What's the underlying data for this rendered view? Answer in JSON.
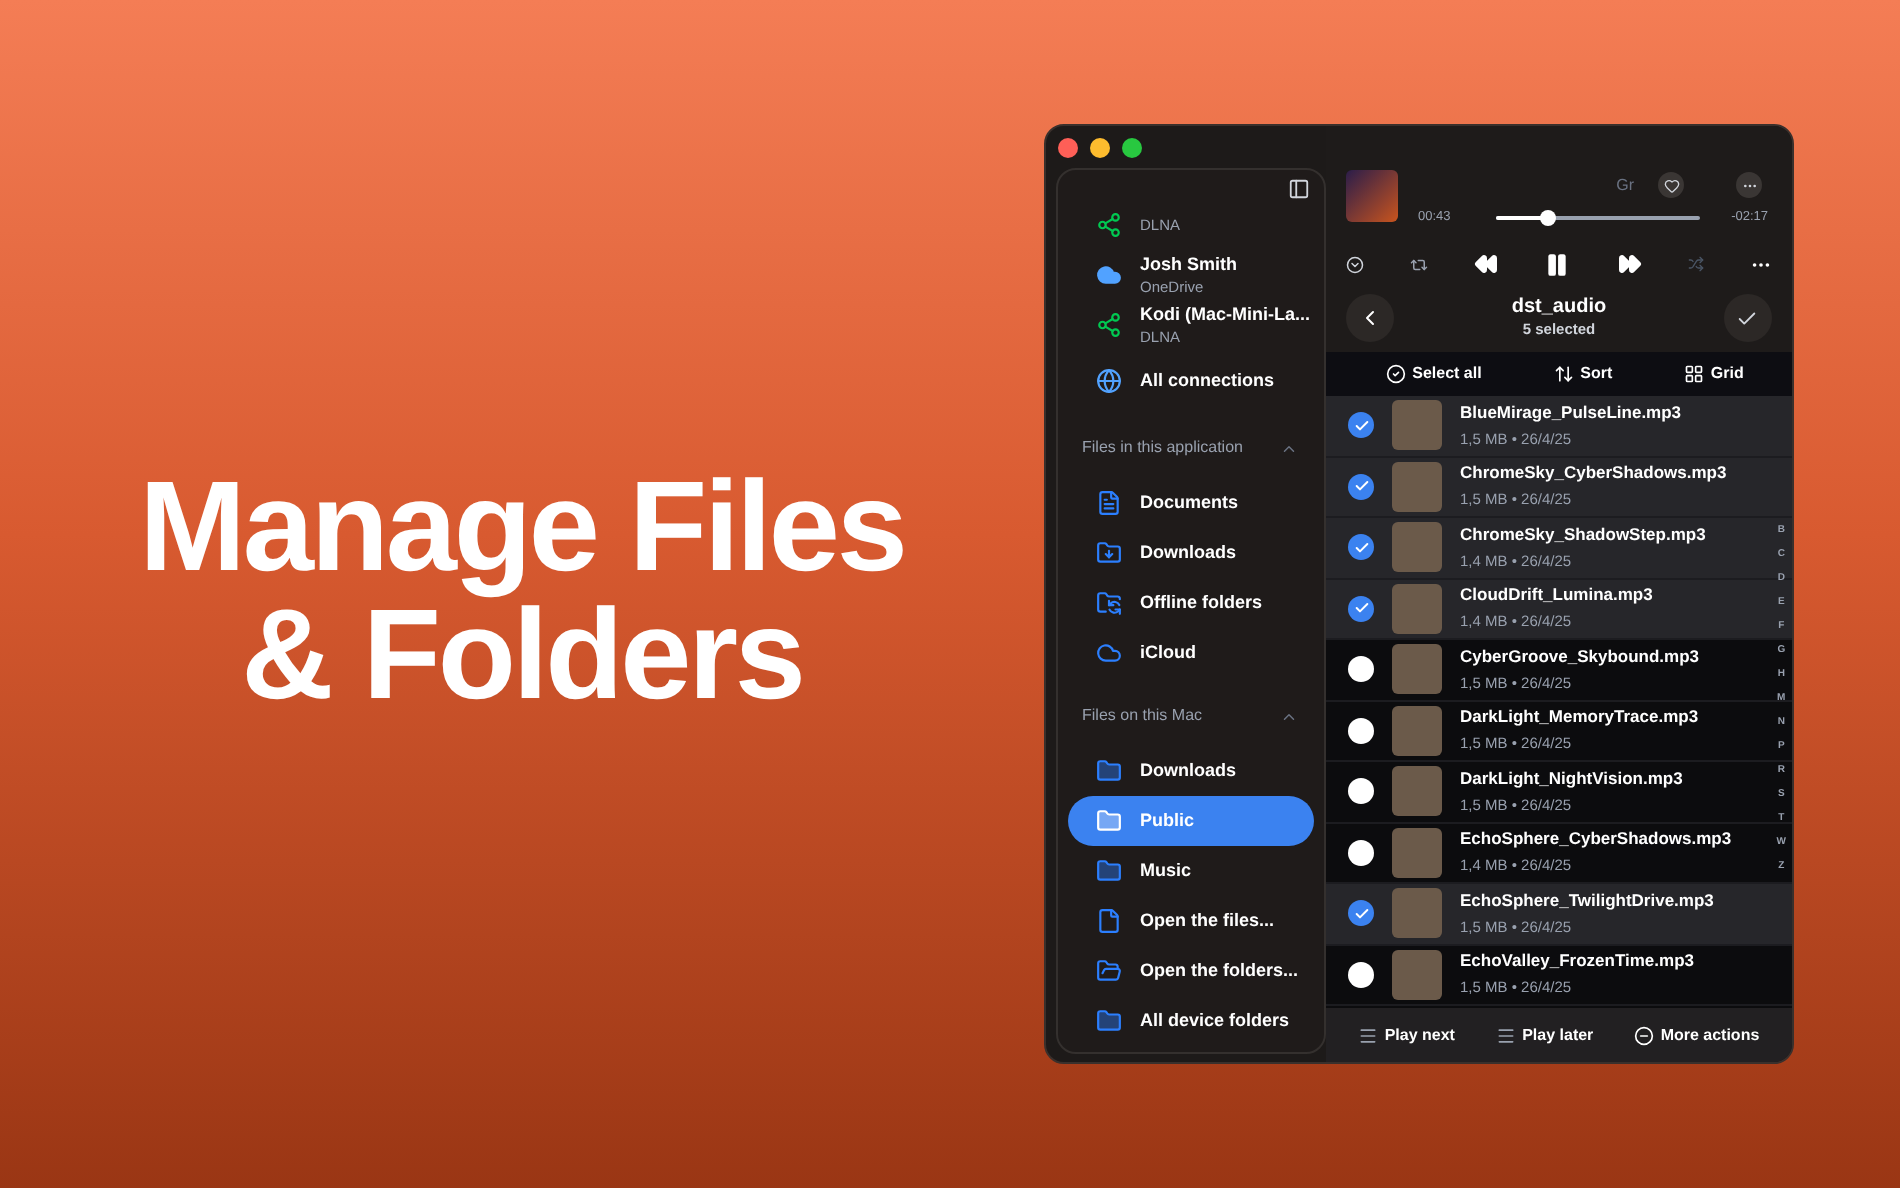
{
  "headline": [
    "Manage Files",
    "& Folders"
  ],
  "sidebar": {
    "connections": [
      {
        "service": "DLNA",
        "kind": "dlna"
      },
      {
        "name": "Josh Smith",
        "service": "OneDrive",
        "kind": "cloud"
      },
      {
        "name": "Kodi (Mac-Mini-La...",
        "service": "DLNA",
        "kind": "dlna"
      },
      {
        "name": "All connections",
        "kind": "globe"
      }
    ],
    "sections": [
      {
        "title": "Files in this application",
        "expanded": true,
        "items": [
          {
            "label": "Documents",
            "kind": "document",
            "selected": false
          },
          {
            "label": "Downloads",
            "kind": "download",
            "selected": false
          },
          {
            "label": "Offline folders",
            "kind": "sync",
            "selected": false
          },
          {
            "label": "iCloud",
            "kind": "cloud",
            "selected": false
          }
        ]
      },
      {
        "title": "Files on this Mac",
        "expanded": true,
        "items": [
          {
            "label": "Downloads",
            "kind": "mac",
            "selected": false
          },
          {
            "label": "Public",
            "kind": "mac",
            "selected": true
          },
          {
            "label": "Music",
            "kind": "mac",
            "selected": false
          },
          {
            "label": "Open the files...",
            "kind": "file",
            "selected": false
          },
          {
            "label": "Open the folders...",
            "kind": "folder",
            "selected": false
          },
          {
            "label": "All device folders",
            "kind": "mac",
            "selected": false
          }
        ]
      }
    ]
  },
  "player": {
    "tag": "Gr",
    "elapsed": "00:43",
    "remaining": "-02:17",
    "level": 0.25
  },
  "folder": {
    "title": "dst_audio",
    "subtitle": "5 selected"
  },
  "toolbar": [
    "Select all",
    "Sort",
    "Grid"
  ],
  "files": [
    {
      "name": "BlueMirage_PulseLine.mp3",
      "meta": "1,5 MB • 26/4/25",
      "selected": true
    },
    {
      "name": "ChromeSky_CyberShadows.mp3",
      "meta": "1,5 MB • 26/4/25",
      "selected": true
    },
    {
      "name": "ChromeSky_ShadowStep.mp3",
      "meta": "1,4 MB • 26/4/25",
      "selected": true
    },
    {
      "name": "CloudDrift_Lumina.mp3",
      "meta": "1,4 MB • 26/4/25",
      "selected": true
    },
    {
      "name": "CyberGroove_Skybound.mp3",
      "meta": "1,5 MB • 26/4/25",
      "selected": false
    },
    {
      "name": "DarkLight_MemoryTrace.mp3",
      "meta": "1,5 MB • 26/4/25",
      "selected": false
    },
    {
      "name": "DarkLight_NightVision.mp3",
      "meta": "1,5 MB • 26/4/25",
      "selected": false
    },
    {
      "name": "EchoSphere_CyberShadows.mp3",
      "meta": "1,4 MB • 26/4/25",
      "selected": false
    },
    {
      "name": "EchoSphere_TwilightDrive.mp3",
      "meta": "1,5 MB • 26/4/25",
      "selected": true
    },
    {
      "name": "EchoValley_FrozenTime.mp3",
      "meta": "1,5 MB • 26/4/25",
      "selected": false
    }
  ],
  "index_letters": [
    "B",
    "C",
    "D",
    "E",
    "F",
    "G",
    "H",
    "M",
    "N",
    "P",
    "R",
    "S",
    "T",
    "W",
    "Z"
  ],
  "footer": [
    "Play next",
    "Play later",
    "More actions"
  ]
}
